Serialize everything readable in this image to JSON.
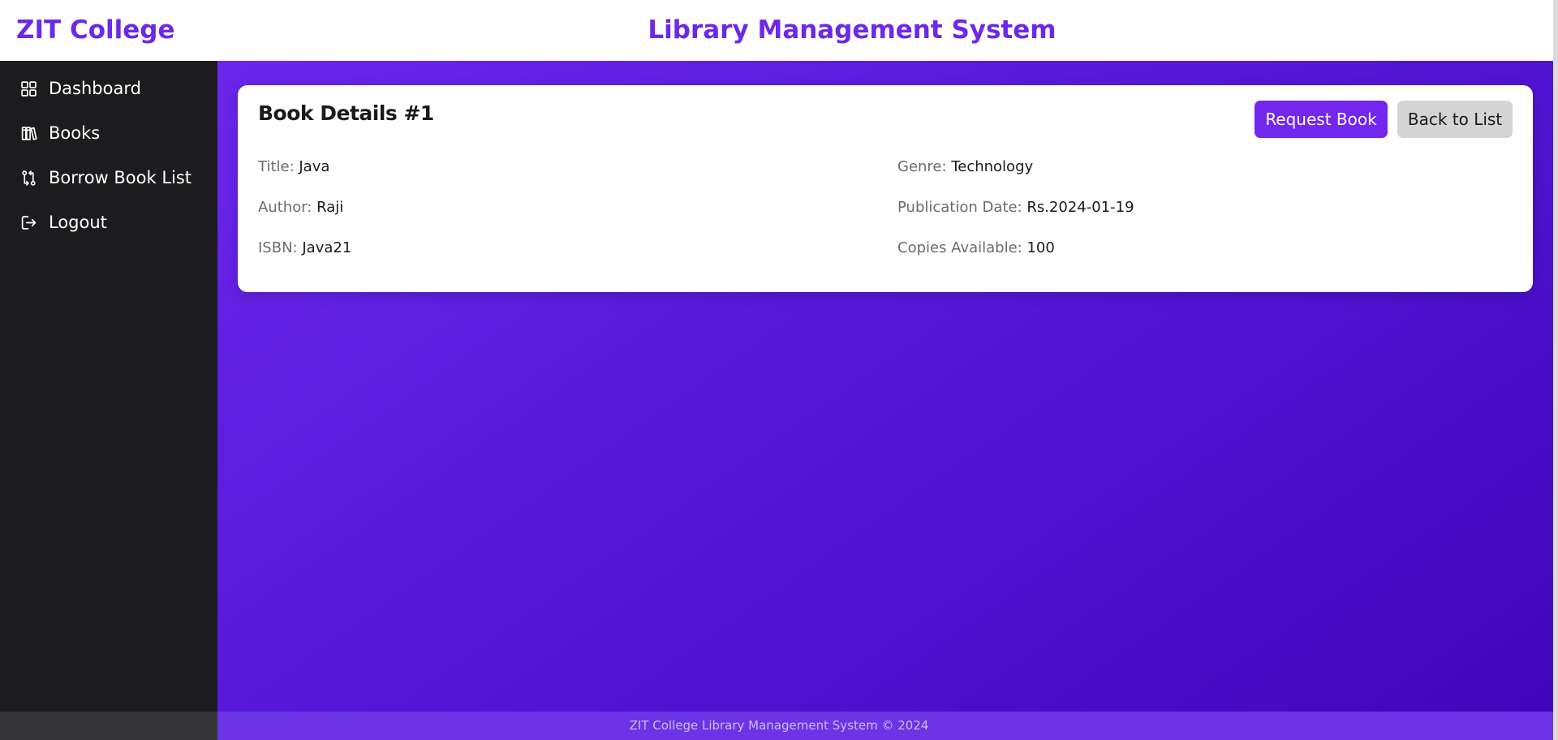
{
  "header": {
    "brand": "ZIT College",
    "title": "Library Management System"
  },
  "sidebar": {
    "items": [
      {
        "label": "Dashboard",
        "icon": "dashboard-grid-icon"
      },
      {
        "label": "Books",
        "icon": "books-icon"
      },
      {
        "label": "Borrow Book List",
        "icon": "borrow-swap-icon"
      },
      {
        "label": "Logout",
        "icon": "logout-icon"
      }
    ]
  },
  "book": {
    "heading": "Book Details #1",
    "request_label": "Request Book",
    "back_label": "Back to List",
    "fields": {
      "title": {
        "label": "Title:",
        "value": "Java"
      },
      "author": {
        "label": "Author:",
        "value": "Raji"
      },
      "isbn": {
        "label": "ISBN:",
        "value": "Java21"
      },
      "genre": {
        "label": "Genre:",
        "value": "Technology"
      },
      "publication_date": {
        "label": "Publication Date:",
        "value": "Rs.2024-01-19"
      },
      "copies": {
        "label": "Copies Available:",
        "value": "100"
      }
    }
  },
  "footer": {
    "text": "ZIT College Library Management System © 2024"
  },
  "colors": {
    "accent": "#6d28e8",
    "sidebar_bg": "#1c1c1e",
    "main_gradient_start": "#6b26ec",
    "main_gradient_end": "#4006bb",
    "secondary_button": "#d4d4d4"
  }
}
